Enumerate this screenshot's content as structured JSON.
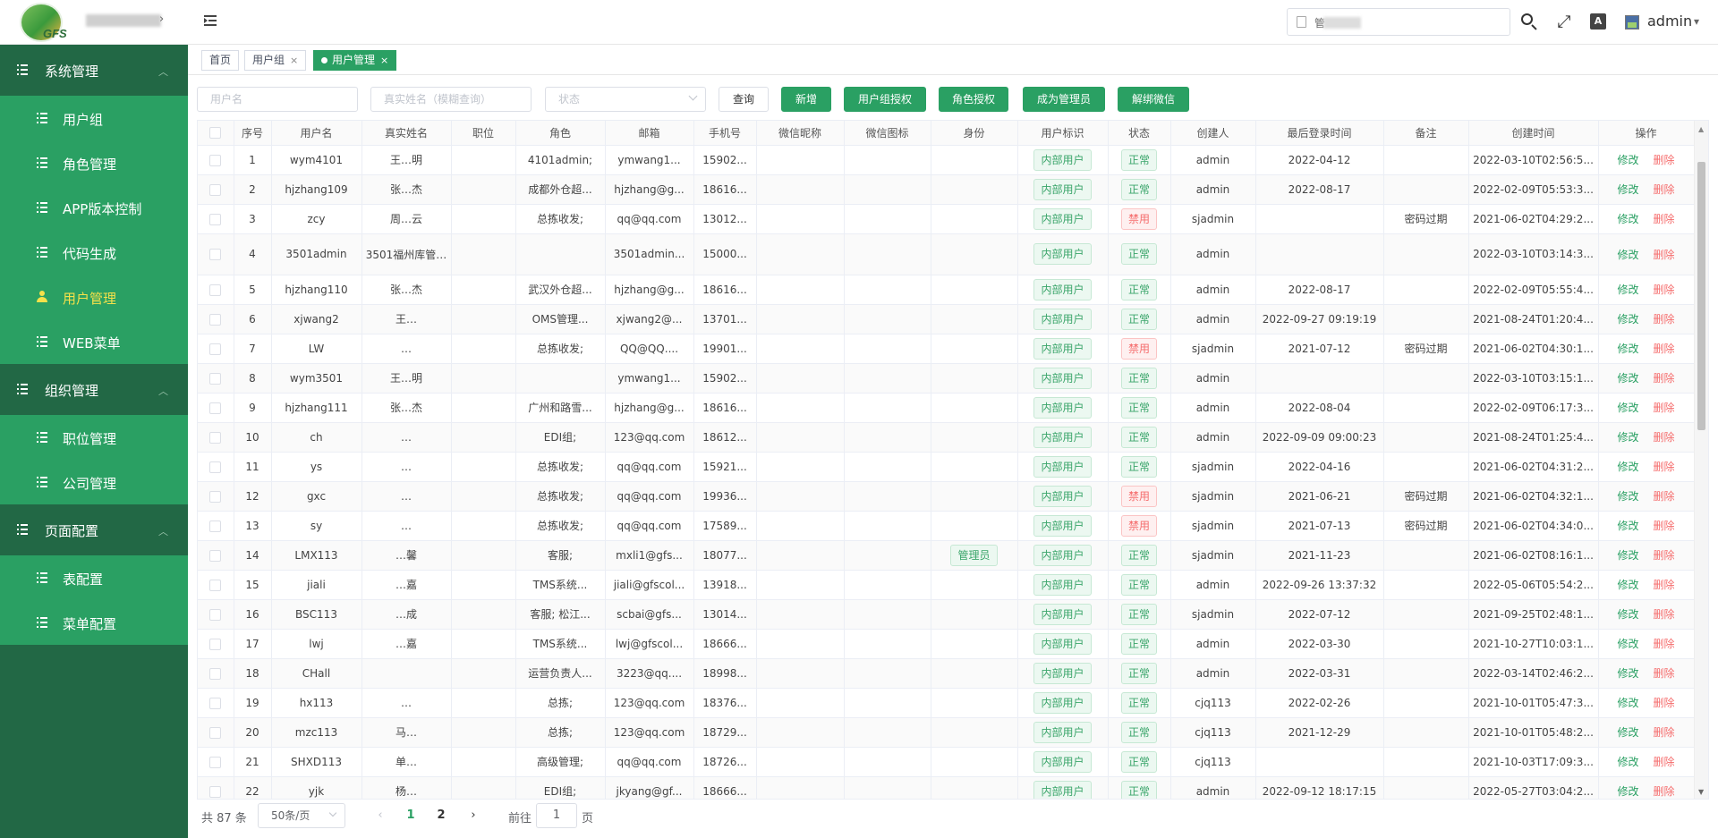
{
  "header": {
    "logo_text": "GFS",
    "search_value": "管",
    "username": "admin",
    "icons": [
      "logo-badge",
      "menu-toggle-icon",
      "document-icon",
      "search-icon",
      "fullscreen-icon",
      "font-size-icon",
      "avatar"
    ]
  },
  "sidebar": {
    "groups": [
      {
        "label": "系统管理",
        "items": [
          "用户组",
          "角色管理",
          "APP版本控制",
          "代码生成",
          "用户管理",
          "WEB菜单"
        ]
      },
      {
        "label": "组织管理",
        "items": [
          "职位管理",
          "公司管理"
        ]
      },
      {
        "label": "页面配置",
        "items": [
          "表配置",
          "菜单配置"
        ]
      }
    ],
    "active_item": "用户管理"
  },
  "tabs": [
    {
      "label": "首页",
      "closable": false
    },
    {
      "label": "用户组",
      "closable": true
    },
    {
      "label": "用户管理",
      "closable": true,
      "active": true
    }
  ],
  "tab_close": "×",
  "filter": {
    "username_placeholder": "用户名",
    "realname_placeholder": "真实姓名（模糊查询）",
    "status_placeholder": "状态",
    "buttons": [
      "查询",
      "新增",
      "用户组授权",
      "角色授权",
      "成为管理员",
      "解绑微信"
    ]
  },
  "table": {
    "columns": [
      "",
      "序号",
      "用户名",
      "真实姓名",
      "职位",
      "角色",
      "邮箱",
      "手机号",
      "微信昵称",
      "微信图标",
      "身份",
      "用户标识",
      "状态",
      "创建人",
      "最后登录时间",
      "备注",
      "创建时间",
      "操作"
    ],
    "op_edit": "修改",
    "op_delete": "删除",
    "rows": [
      {
        "no": "1",
        "username": "wym4101",
        "realname": "王…明",
        "role": "4101admin;",
        "email": "ymwang1...",
        "phone": "15902...",
        "identity": "",
        "flag": "内部用户",
        "status": "正常",
        "creator": "admin",
        "last_login": "2022-04-12",
        "remark": "",
        "created": "2022-03-10T02:56:5..."
      },
      {
        "no": "2",
        "username": "hjzhang109",
        "realname": "张…杰",
        "role": "成都外仓超...",
        "email": "hjzhang@g...",
        "phone": "18616...",
        "identity": "",
        "flag": "内部用户",
        "status": "正常",
        "creator": "admin",
        "last_login": "2022-08-17",
        "remark": "",
        "created": "2022-02-09T05:53:3..."
      },
      {
        "no": "3",
        "username": "zcy",
        "realname": "周…云",
        "role": "总拣收发;",
        "email": "qq@qq.com",
        "phone": "13012...",
        "identity": "",
        "flag": "内部用户",
        "status": "禁用",
        "creator": "sjadmin",
        "last_login": "",
        "remark": "密码过期",
        "created": "2021-06-02T04:29:2..."
      },
      {
        "no": "4",
        "username": "3501admin",
        "realname": "3501福州库管…",
        "role": "",
        "email": "3501admin...",
        "phone": "15000...",
        "identity": "",
        "flag": "内部用户",
        "status": "正常",
        "creator": "admin",
        "last_login": "",
        "remark": "",
        "created": "2022-03-10T03:14:3...",
        "tall": true
      },
      {
        "no": "5",
        "username": "hjzhang110",
        "realname": "张…杰",
        "role": "武汉外仓超...",
        "email": "hjzhang@g...",
        "phone": "18616...",
        "identity": "",
        "flag": "内部用户",
        "status": "正常",
        "creator": "admin",
        "last_login": "2022-08-17",
        "remark": "",
        "created": "2022-02-09T05:55:4..."
      },
      {
        "no": "6",
        "username": "xjwang2",
        "realname": "王…",
        "role": "OMS管理...",
        "email": "xjwang2@...",
        "phone": "13701...",
        "identity": "",
        "flag": "内部用户",
        "status": "正常",
        "creator": "admin",
        "last_login": "2022-09-27 09:19:19",
        "remark": "",
        "created": "2021-08-24T01:20:4..."
      },
      {
        "no": "7",
        "username": "LW",
        "realname": "…",
        "role": "总拣收发;",
        "email": "QQ@QQ....",
        "phone": "19901...",
        "identity": "",
        "flag": "内部用户",
        "status": "禁用",
        "creator": "sjadmin",
        "last_login": "2021-07-12",
        "remark": "密码过期",
        "created": "2021-06-02T04:30:1..."
      },
      {
        "no": "8",
        "username": "wym3501",
        "realname": "王…明",
        "role": "",
        "email": "ymwang1...",
        "phone": "15902...",
        "identity": "",
        "flag": "内部用户",
        "status": "正常",
        "creator": "admin",
        "last_login": "",
        "remark": "",
        "created": "2022-03-10T03:15:1..."
      },
      {
        "no": "9",
        "username": "hjzhang111",
        "realname": "张…杰",
        "role": "广州和路雪...",
        "email": "hjzhang@g...",
        "phone": "18616...",
        "identity": "",
        "flag": "内部用户",
        "status": "正常",
        "creator": "admin",
        "last_login": "2022-08-04",
        "remark": "",
        "created": "2022-02-09T06:17:3..."
      },
      {
        "no": "10",
        "username": "ch",
        "realname": "…",
        "role": "EDI组;",
        "email": "123@qq.com",
        "phone": "18612...",
        "identity": "",
        "flag": "内部用户",
        "status": "正常",
        "creator": "admin",
        "last_login": "2022-09-09 09:00:23",
        "remark": "",
        "created": "2021-08-24T01:25:4..."
      },
      {
        "no": "11",
        "username": "ys",
        "realname": "…",
        "role": "总拣收发;",
        "email": "qq@qq.com",
        "phone": "15921...",
        "identity": "",
        "flag": "内部用户",
        "status": "正常",
        "creator": "sjadmin",
        "last_login": "2022-04-16",
        "remark": "",
        "created": "2021-06-02T04:31:2..."
      },
      {
        "no": "12",
        "username": "gxc",
        "realname": "…",
        "role": "总拣收发;",
        "email": "qq@qq.com",
        "phone": "19936...",
        "identity": "",
        "flag": "内部用户",
        "status": "禁用",
        "creator": "sjadmin",
        "last_login": "2021-06-21",
        "remark": "密码过期",
        "created": "2021-06-02T04:32:1..."
      },
      {
        "no": "13",
        "username": "sy",
        "realname": "…",
        "role": "总拣收发;",
        "email": "qq@qq.com",
        "phone": "17589...",
        "identity": "",
        "flag": "内部用户",
        "status": "禁用",
        "creator": "sjadmin",
        "last_login": "2021-07-13",
        "remark": "密码过期",
        "created": "2021-06-02T04:34:0..."
      },
      {
        "no": "14",
        "username": "LMX113",
        "realname": "…馨",
        "role": "客服;",
        "email": "mxli1@gfs...",
        "phone": "18077...",
        "identity": "管理员",
        "flag": "内部用户",
        "status": "正常",
        "creator": "sjadmin",
        "last_login": "2021-11-23",
        "remark": "",
        "created": "2021-06-02T08:16:1..."
      },
      {
        "no": "15",
        "username": "jiali",
        "realname": "…嘉",
        "role": "TMS系统...",
        "email": "jiali@gfscol...",
        "phone": "13918...",
        "identity": "",
        "flag": "内部用户",
        "status": "正常",
        "creator": "admin",
        "last_login": "2022-09-26 13:37:32",
        "remark": "",
        "created": "2022-05-06T05:54:2..."
      },
      {
        "no": "16",
        "username": "BSC113",
        "realname": "…成",
        "role": "客服; 松江...",
        "email": "scbai@gfs...",
        "phone": "13014...",
        "identity": "",
        "flag": "内部用户",
        "status": "正常",
        "creator": "sjadmin",
        "last_login": "2022-07-12",
        "remark": "",
        "created": "2021-09-25T02:48:1..."
      },
      {
        "no": "17",
        "username": "lwj",
        "realname": "…嘉",
        "role": "TMS系统...",
        "email": "lwj@gfscol...",
        "phone": "18666...",
        "identity": "",
        "flag": "内部用户",
        "status": "正常",
        "creator": "admin",
        "last_login": "2022-03-30",
        "remark": "",
        "created": "2021-10-27T10:03:1..."
      },
      {
        "no": "18",
        "username": "CHall",
        "realname": "",
        "role": "运营负责人...",
        "email": "3223@qq....",
        "phone": "18998...",
        "identity": "",
        "flag": "内部用户",
        "status": "正常",
        "creator": "admin",
        "last_login": "2022-03-31",
        "remark": "",
        "created": "2022-03-14T02:46:2..."
      },
      {
        "no": "19",
        "username": "hx113",
        "realname": "…",
        "role": "总拣;",
        "email": "123@qq.com",
        "phone": "18376...",
        "identity": "",
        "flag": "内部用户",
        "status": "正常",
        "creator": "cjq113",
        "last_login": "2022-02-26",
        "remark": "",
        "created": "2021-10-01T05:47:3..."
      },
      {
        "no": "20",
        "username": "mzc113",
        "realname": "马…",
        "role": "总拣;",
        "email": "123@qq.com",
        "phone": "18729...",
        "identity": "",
        "flag": "内部用户",
        "status": "正常",
        "creator": "cjq113",
        "last_login": "2021-12-29",
        "remark": "",
        "created": "2021-10-01T05:48:2..."
      },
      {
        "no": "21",
        "username": "SHXD113",
        "realname": "单…",
        "role": "高级管理;",
        "email": "qq@qq.com",
        "phone": "18726...",
        "identity": "",
        "flag": "内部用户",
        "status": "正常",
        "creator": "cjq113",
        "last_login": "",
        "remark": "",
        "created": "2021-10-03T17:09:3..."
      },
      {
        "no": "22",
        "username": "yjk",
        "realname": "杨…",
        "role": "EDI组;",
        "email": "jkyang@gf...",
        "phone": "18666...",
        "identity": "",
        "flag": "内部用户",
        "status": "正常",
        "creator": "admin",
        "last_login": "2022-09-12 18:17:15",
        "remark": "",
        "created": "2022-05-27T03:04:2..."
      }
    ]
  },
  "pager": {
    "total": "共 87 条",
    "page_size": "50条/页",
    "pages": [
      "1",
      "2"
    ],
    "current": "1",
    "goto_label": "前往",
    "goto_value": "1",
    "page_suffix": "页",
    "prev": "‹",
    "next": "›"
  },
  "colors": {
    "sidebar": "#226845",
    "sidebar_item": "#2aa063",
    "accent": "#2aa063",
    "active_text": "#f5e14a",
    "danger": "#f56c6c"
  }
}
